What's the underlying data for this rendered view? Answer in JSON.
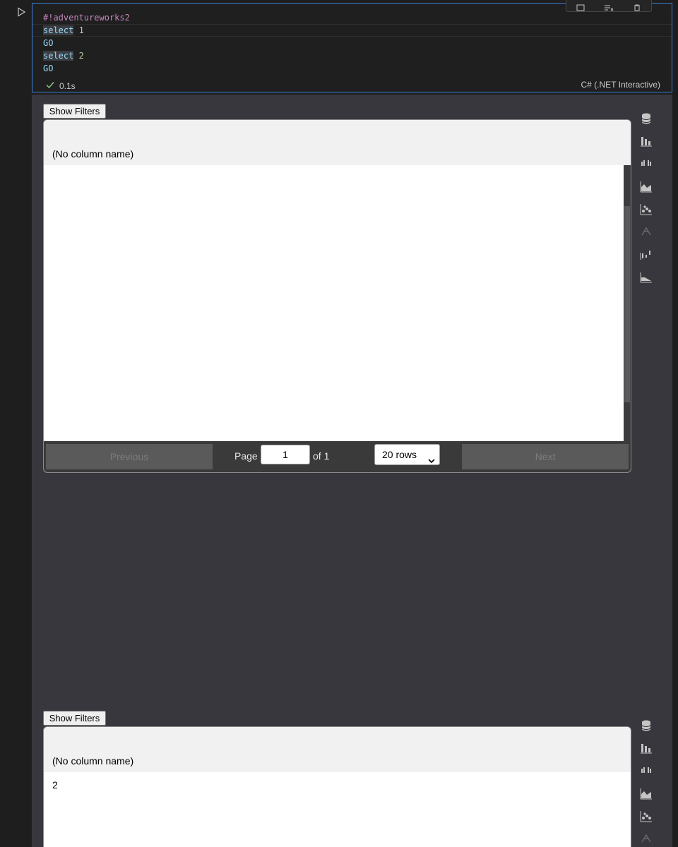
{
  "cell": {
    "code_lines": [
      {
        "parts": [
          {
            "t": "#!adventureworks2",
            "c": "kw-magic"
          }
        ]
      },
      {
        "parts": [
          {
            "t": "select",
            "c": "kw-select"
          },
          {
            "t": " "
          },
          {
            "t": "1",
            "c": "num"
          }
        ]
      },
      {
        "parts": [
          {
            "t": "GO",
            "c": "kw-go"
          }
        ]
      },
      {
        "parts": [
          {
            "t": "select",
            "c": "kw-select"
          },
          {
            "t": " "
          },
          {
            "t": "2",
            "c": "num"
          }
        ]
      },
      {
        "parts": [
          {
            "t": "GO",
            "c": "kw-go"
          }
        ]
      }
    ],
    "duration": "0.1s",
    "kernel": "C# (.NET Interactive)"
  },
  "results": [
    {
      "show_filters": "Show Filters",
      "column_header": "(No column name)",
      "cells": [],
      "pager": {
        "previous": "Previous",
        "page_label": "Page",
        "page_value": "1",
        "of_label": "of 1",
        "rows_option": "20 rows",
        "next": "Next"
      }
    },
    {
      "show_filters": "Show Filters",
      "column_header": "(No column name)",
      "cells": [
        "2"
      ]
    }
  ],
  "visualization_icons": [
    "database-icon",
    "bar-chart-icon",
    "grouped-bar-icon",
    "area-chart-icon",
    "scatter-chart-icon",
    "network-icon",
    "box-plot-icon",
    "line-chart-icon"
  ]
}
